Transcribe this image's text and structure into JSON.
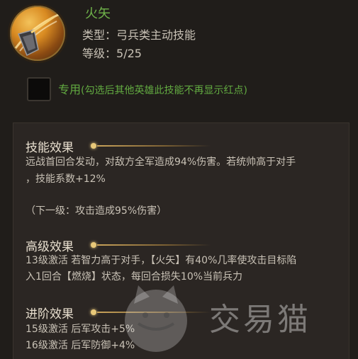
{
  "skill": {
    "name": "火矢",
    "type_label": "类型：",
    "type_value": "弓兵类主动技能",
    "level_label": "等级：",
    "level_value": "5/25",
    "icon": "flaming-arrow-icon"
  },
  "exclusive": {
    "label": "专用",
    "note": "(勾选后其他英雄此技能不再显示红点)"
  },
  "effect": {
    "title": "技能效果",
    "lines": [
      "远战首回合发动，对敌方全军造成94%伤害。若统帅高于对手",
      "，技能系数+12%"
    ],
    "next_level": "（下一级：攻击造成95%伤害）"
  },
  "advanced": {
    "title": "高级效果",
    "lines": [
      "13级激活 若智力高于对手，【火矢】有40%几率使攻击目标陷",
      "入1回合【燃烧】状态，每回合损失10%当前兵力"
    ]
  },
  "promotion": {
    "title": "进阶效果",
    "lines": [
      "15级激活 后军攻击+5%",
      "16级激活 后军防御+4%"
    ]
  },
  "watermark": {
    "text": "交易猫",
    "icon": "cat-logo-icon"
  },
  "colors": {
    "background": "#201d1a",
    "name_green": "#6fb24a",
    "text": "#c9c2b6",
    "title": "#e8dfcf",
    "gold_line": "#c9a35a"
  }
}
